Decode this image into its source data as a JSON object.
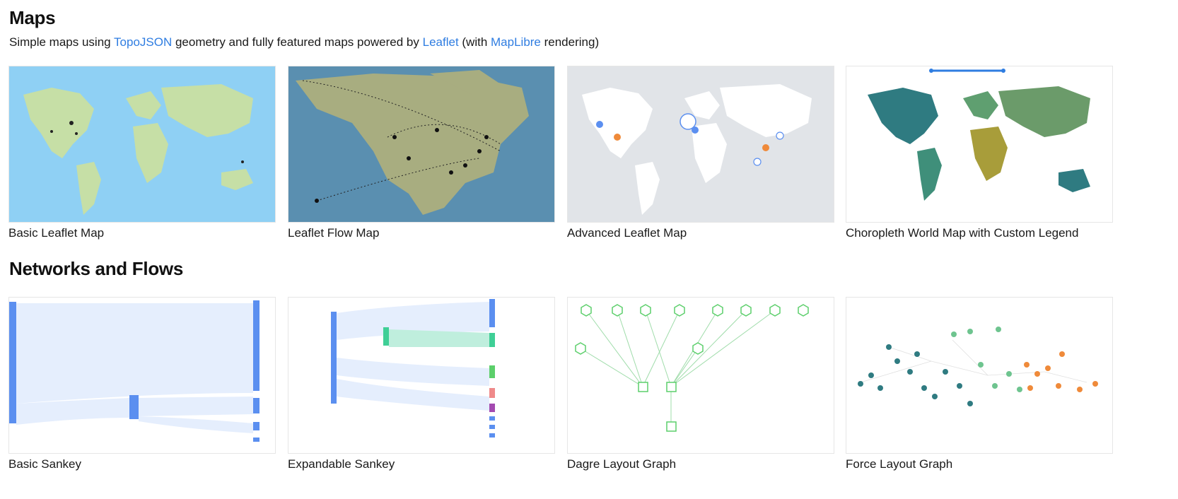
{
  "colors": {
    "link": "#2f7de1",
    "ocean_light": "#8fd0f4",
    "land_light": "#c6dfa6",
    "ocean_dark": "#5a8fb0",
    "land_dark": "#a8ad80",
    "land_grey": "#ffffff",
    "sea_grey": "#e1e4e8",
    "sankey_blue": "#5b8ff0",
    "sankey_flow": "#e5eefd",
    "dagre_green": "#5ccf6b",
    "force_teal": "#2f7b81",
    "force_green": "#6ec48f",
    "force_orange": "#ef8a3a"
  },
  "maps": {
    "title": "Maps",
    "subtitle": {
      "part1": "Simple maps using ",
      "link1": "TopoJSON",
      "part2": " geometry and fully featured maps powered by ",
      "link2": "Leaflet",
      "part3": " (with ",
      "link3": "MapLibre",
      "part4": " rendering)"
    },
    "cards": [
      {
        "label": "Basic Leaflet Map",
        "icon": "world-map-thumbnail"
      },
      {
        "label": "Leaflet Flow Map",
        "icon": "flow-map-thumbnail"
      },
      {
        "label": "Advanced Leaflet Map",
        "icon": "cluster-map-thumbnail"
      },
      {
        "label": "Choropleth World Map with Custom Legend",
        "icon": "choropleth-thumbnail"
      }
    ]
  },
  "networks": {
    "title": "Networks and Flows",
    "cards": [
      {
        "label": "Basic Sankey",
        "icon": "sankey-thumbnail"
      },
      {
        "label": "Expandable Sankey",
        "icon": "expandable-sankey-thumbnail"
      },
      {
        "label": "Dagre Layout Graph",
        "icon": "dagre-graph-thumbnail"
      },
      {
        "label": "Force Layout Graph",
        "icon": "force-graph-thumbnail"
      }
    ]
  }
}
